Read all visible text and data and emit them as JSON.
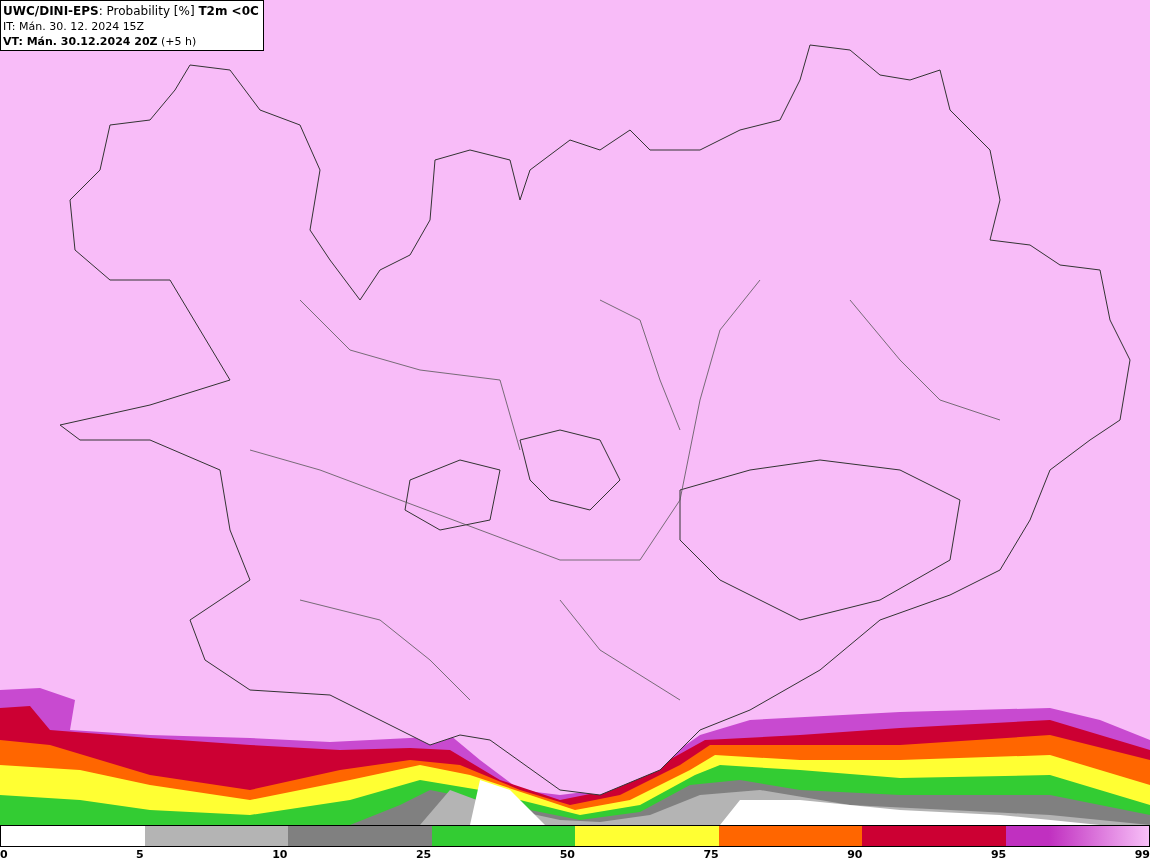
{
  "header": {
    "title": "**UWC/DINI-EPS**: Probability [%] **T2m <0C**",
    "init_time": "IT: Mán. 30. 12. 2024 15Z",
    "valid_time": "**VT: Mán. 30.12.2024 20Z** (+5 h)"
  },
  "legend": {
    "segments": [
      {
        "color": "#ffffff"
      },
      {
        "color": "#b4b4b4"
      },
      {
        "color": "#808080"
      },
      {
        "color": "#33cc33"
      },
      {
        "color": "#ffff33"
      },
      {
        "color": "#ff6600"
      },
      {
        "color": "#cc0033"
      },
      {
        "color": "#c030c0"
      }
    ],
    "labels": [
      "0",
      "5",
      "10",
      "25",
      "50",
      "75",
      "90",
      "95",
      "99"
    ]
  }
}
